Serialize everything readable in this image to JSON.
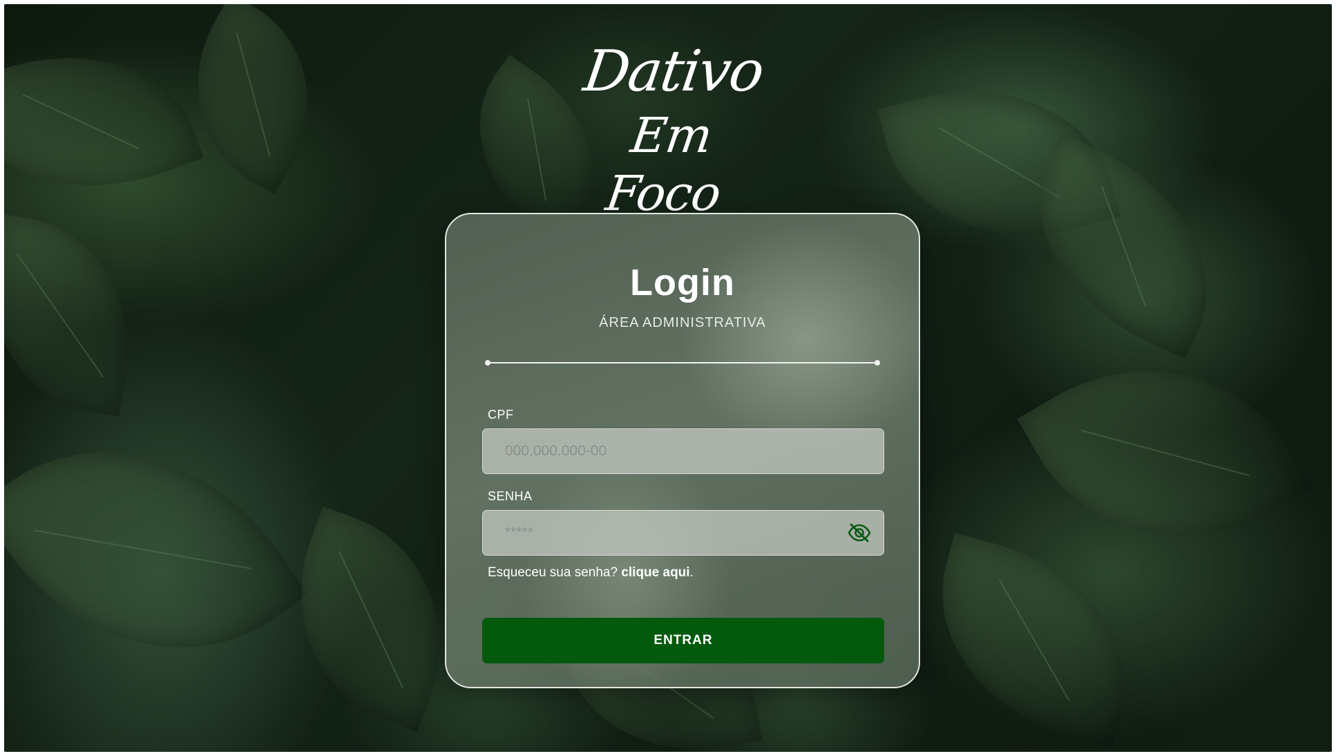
{
  "brand": {
    "line1": "Dativo",
    "line2": "Em Foco"
  },
  "login": {
    "title": "Login",
    "subtitle": "ÁREA ADMINISTRATIVA",
    "cpf": {
      "label": "CPF",
      "placeholder": "000.000.000-00",
      "value": ""
    },
    "password": {
      "label": "SENHA",
      "placeholder": "*****",
      "toggle_icon": "eye-off-icon"
    },
    "forgot_prefix": "Esqueceu sua senha?",
    "forgot_link": "clique aqui",
    "forgot_suffix": ".",
    "submit_label": "ENTRAR"
  },
  "colors": {
    "primary_button": "#035a0c",
    "eye_icon": "#0a5a14"
  }
}
